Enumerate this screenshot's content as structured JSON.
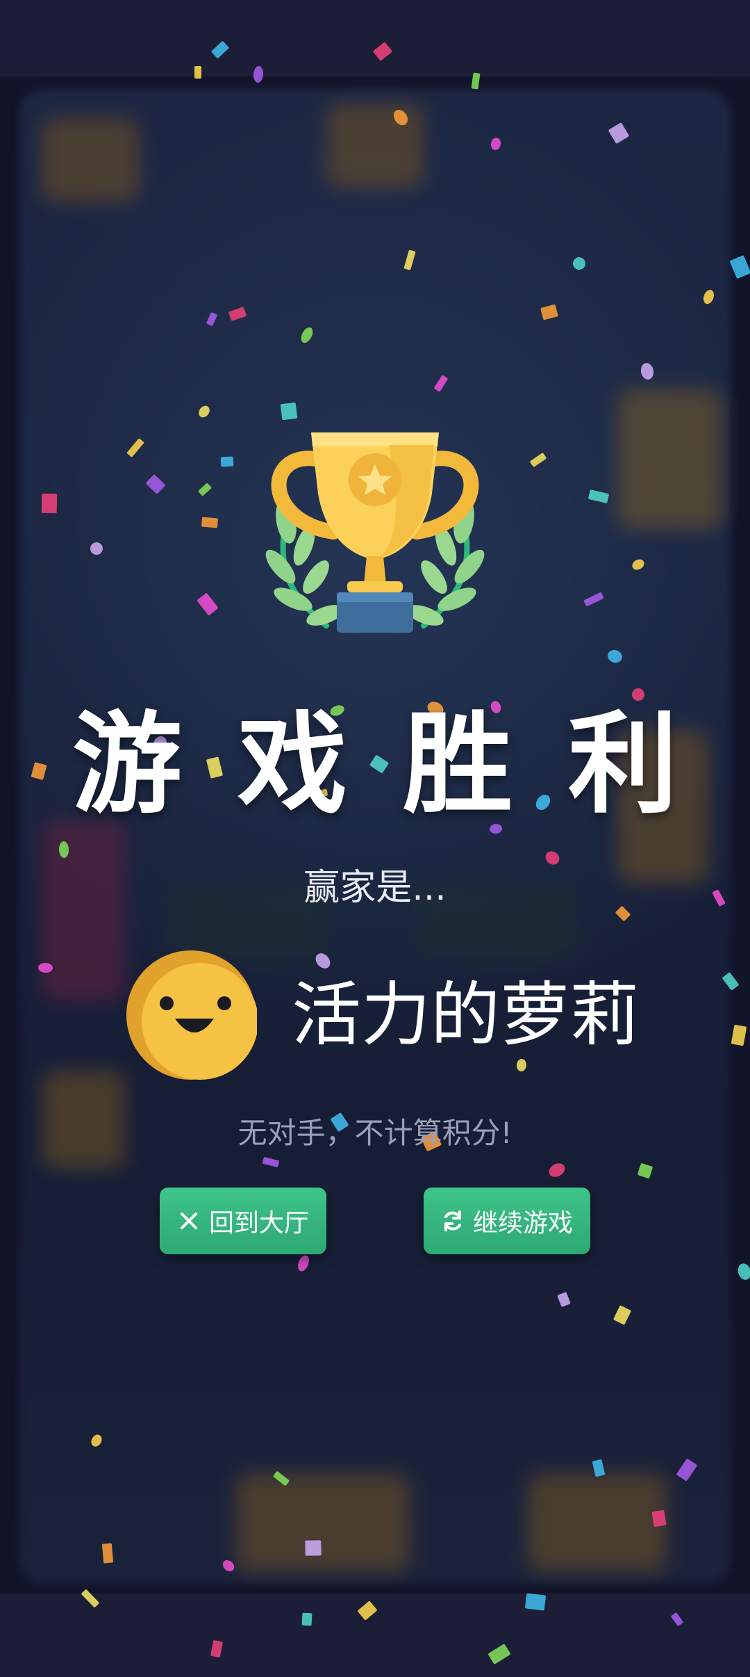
{
  "title": "游戏胜利",
  "winner_label": "赢家是...",
  "winner": {
    "name": "活力的萝莉",
    "avatar_icon": "smiley-face-icon",
    "avatar_color": "#f6c243"
  },
  "note": "无对手，不计算积分!",
  "buttons": {
    "lobby": {
      "label": "回到大厅",
      "icon": "close-icon"
    },
    "continue": {
      "label": "继续游戏",
      "icon": "refresh-icon"
    }
  },
  "colors": {
    "button": "#35b57e",
    "trophy": "#f7c94d",
    "background": "#16192f"
  }
}
